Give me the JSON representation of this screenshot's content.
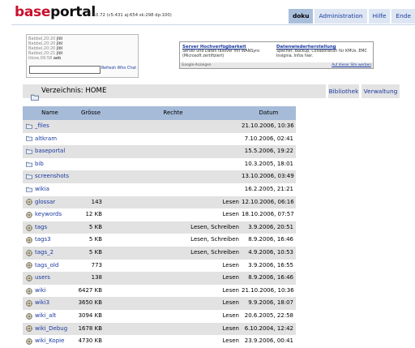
{
  "header": {
    "brand_base": "base",
    "brand_portal": "portal",
    "version": "3.0.72 (c5:431 aj:654 sk:298 dp:100)",
    "nav": [
      "doku",
      "Administration",
      "Hilfe",
      "Ende"
    ],
    "active_nav": "doku"
  },
  "chat": {
    "lines": [
      {
        "meta": "Babbel,20:20",
        "text": "jlöl"
      },
      {
        "meta": "Babbel,20:20",
        "text": "jlöl"
      },
      {
        "meta": "Babbel,20:20",
        "text": "jlöl"
      },
      {
        "meta": "Babbel,20:21",
        "text": "jlöl"
      },
      {
        "meta": "tikow,09:58",
        "text": "aeb"
      }
    ],
    "input_value": "",
    "refresh_label": "Refresh Who Chat"
  },
  "ads": {
    "ad1": {
      "title": "Server Hochverfügbarkeit",
      "line1": "Server und Daten failover mit WANSync",
      "line2": "(Microsoft zertifiziert)"
    },
    "ad2": {
      "title": "Datenwiederherstellung",
      "line1": "Specher, Backup, Collaboration für KMUs. EMC",
      "line2": "Insignia. Infos hier."
    },
    "footer_left": "Google-Anzeigen",
    "footer_right": "Auf dieser Site werben"
  },
  "section": {
    "title": "Verzeichnis: HOME",
    "buttons": [
      "Bibliothek",
      "Verwaltung"
    ]
  },
  "table": {
    "columns": [
      "Name",
      "Grösse",
      "Rechte",
      "Datum"
    ],
    "rows": [
      {
        "type": "folder",
        "name": "_files",
        "size": "",
        "rights": "",
        "date": "21.10.2006, 10:36"
      },
      {
        "type": "folder",
        "name": "altkram",
        "size": "",
        "rights": "",
        "date": "7.10.2006, 02:41"
      },
      {
        "type": "folder",
        "name": "baseportal",
        "size": "",
        "rights": "",
        "date": "15.5.2006, 19:22"
      },
      {
        "type": "folder",
        "name": "bib",
        "size": "",
        "rights": "",
        "date": "10.3.2005, 18:01"
      },
      {
        "type": "folder",
        "name": "screenshots",
        "size": "",
        "rights": "",
        "date": "13.10.2006, 03:49"
      },
      {
        "type": "folder",
        "name": "wikia",
        "size": "",
        "rights": "",
        "date": "16.2.2005, 21:21"
      },
      {
        "type": "db",
        "name": "glossar",
        "size": "143",
        "rights": "Lesen",
        "date": "12.10.2006, 06:16"
      },
      {
        "type": "db",
        "name": "keywords",
        "size": "12 KB",
        "rights": "Lesen",
        "date": "18.10.2006, 07:57"
      },
      {
        "type": "db",
        "name": "tags",
        "size": "5 KB",
        "rights": "Lesen, Schreiben",
        "date": "3.9.2006, 20:51"
      },
      {
        "type": "db",
        "name": "tags3",
        "size": "5 KB",
        "rights": "Lesen, Schreiben",
        "date": "8.9.2006, 16:46"
      },
      {
        "type": "db",
        "name": "tags_2",
        "size": "5 KB",
        "rights": "Lesen, Schreiben",
        "date": "4.9.2006, 10:53"
      },
      {
        "type": "db",
        "name": "tags_old",
        "size": "773",
        "rights": "Lesen",
        "date": "3.9.2006, 16:55"
      },
      {
        "type": "db",
        "name": "users",
        "size": "138",
        "rights": "Lesen",
        "date": "8.9.2006, 16:46"
      },
      {
        "type": "db",
        "name": "wiki",
        "size": "6427 KB",
        "rights": "Lesen",
        "date": "21.10.2006, 10:36"
      },
      {
        "type": "db",
        "name": "wiki3",
        "size": "3650 KB",
        "rights": "Lesen",
        "date": "9.9.2006, 18:07"
      },
      {
        "type": "db",
        "name": "wiki_alt",
        "size": "3094 KB",
        "rights": "Lesen",
        "date": "20.6.2005, 22:58"
      },
      {
        "type": "db",
        "name": "wiki_Debug",
        "size": "1678 KB",
        "rights": "Lesen",
        "date": "6.10.2004, 12:42"
      },
      {
        "type": "db",
        "name": "wiki_Kopie",
        "size": "4730 KB",
        "rights": "Lesen",
        "date": "23.9.2006, 00:41"
      }
    ]
  },
  "colors": {
    "brand_red": "#c8102e",
    "link": "#1a3aa0",
    "header_blue": "#a6bbd8",
    "row_gray": "#e2e2e2"
  }
}
